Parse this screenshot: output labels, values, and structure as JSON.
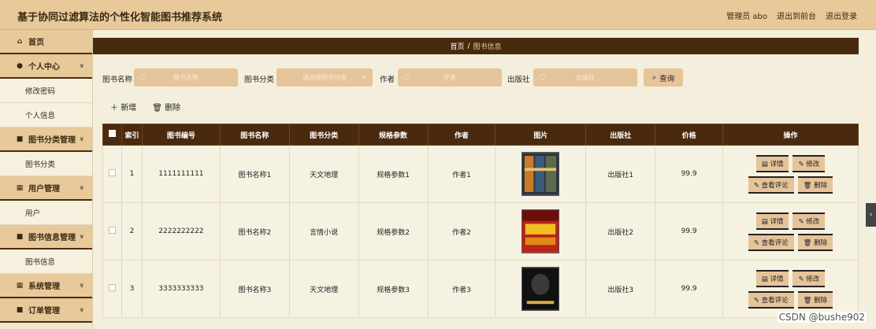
{
  "app": {
    "title": "基于协同过滤算法的个性化智能图书推荐系统"
  },
  "header": {
    "user": "管理员 abo",
    "to_front": "退出到前台",
    "logout": "退出登录"
  },
  "sidebar": {
    "items": [
      {
        "label": "首页",
        "icon": "home-icon",
        "type": "top"
      },
      {
        "label": "个人中心",
        "icon": "user-icon",
        "type": "group"
      },
      {
        "label": "修改密码",
        "type": "sub"
      },
      {
        "label": "个人信息",
        "type": "sub"
      },
      {
        "label": "图书分类管理",
        "icon": "book-icon",
        "type": "group"
      },
      {
        "label": "图书分类",
        "type": "sub"
      },
      {
        "label": "用户管理",
        "icon": "grid-icon",
        "type": "group"
      },
      {
        "label": "用户",
        "type": "sub"
      },
      {
        "label": "图书信息管理",
        "icon": "book-icon",
        "type": "group"
      },
      {
        "label": "图书信息",
        "type": "sub"
      },
      {
        "label": "系统管理",
        "icon": "grid-icon",
        "type": "group"
      },
      {
        "label": "订单管理",
        "icon": "book-icon",
        "type": "group"
      }
    ]
  },
  "breadcrumb": {
    "home": "首页",
    "sep": "/",
    "current": "图书信息"
  },
  "filters": {
    "name_label": "图书名称",
    "name_placeholder": "图书名称",
    "category_label": "图书分类",
    "category_placeholder": "请选择图书分类",
    "author_label": "作者",
    "author_placeholder": "作者",
    "publisher_label": "出版社",
    "publisher_placeholder": "出版社",
    "search_label": "查询"
  },
  "actions": {
    "add": "新增",
    "delete": "删除"
  },
  "table": {
    "headers": [
      "索引",
      "图书编号",
      "图书名称",
      "图书分类",
      "规格参数",
      "作者",
      "图片",
      "出版社",
      "价格",
      "操作"
    ],
    "rows": [
      {
        "idx": "1",
        "code": "1111111111",
        "name": "图书名称1",
        "category": "天文地理",
        "spec": "规格参数1",
        "author": "作者1",
        "publisher": "出版社1",
        "price": "99.9"
      },
      {
        "idx": "2",
        "code": "2222222222",
        "name": "图书名称2",
        "category": "言情小说",
        "spec": "规格参数2",
        "author": "作者2",
        "publisher": "出版社2",
        "price": "99.9"
      },
      {
        "idx": "3",
        "code": "3333333333",
        "name": "图书名称3",
        "category": "天文地理",
        "spec": "规格参数3",
        "author": "作者3",
        "publisher": "出版社3",
        "price": "99.9"
      }
    ],
    "ops": {
      "detail": "详情",
      "edit": "修改",
      "comments": "查看评论",
      "delete": "删除"
    }
  },
  "watermark": "CSDN @bushe902",
  "colors": {
    "header_bg": "#e8c99a",
    "dark_brown": "#4a2a0e",
    "page_bg": "#f3efdc"
  }
}
